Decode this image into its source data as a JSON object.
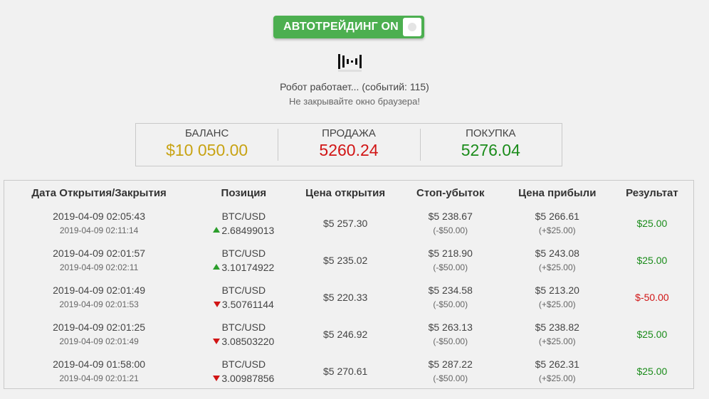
{
  "toggle": {
    "label": "АВТОТРЕЙДИНГ ON",
    "state": "on",
    "color": "#4caf50"
  },
  "status": {
    "loader_icon": "audio-bars-loader-icon",
    "main": "Робот работает... (событий: 115)",
    "sub": "Не закрывайте окно браузера!"
  },
  "stats": {
    "balance": {
      "label": "БАЛАНС",
      "value": "$10 050.00",
      "color": "#c8a313"
    },
    "sell": {
      "label": "ПРОДАЖА",
      "value": "5260.24",
      "color": "#d11515"
    },
    "buy": {
      "label": "ПОКУПКА",
      "value": "5276.04",
      "color": "#1b8c1b"
    }
  },
  "table": {
    "headers": [
      "Дата Открытия/Закрытия",
      "Позиция",
      "Цена открытия",
      "Стоп-убыток",
      "Цена прибыли",
      "Результат"
    ],
    "rows": [
      {
        "open_date": "2019-04-09 02:05:43",
        "close_date": "2019-04-09 02:11:14",
        "pair": "BTC/USD",
        "direction": "up",
        "qty": "2.68499013",
        "open_price": "$5 257.30",
        "stop_loss": "$5 238.67",
        "stop_loss_delta": "(-$50.00)",
        "take_profit": "$5 266.61",
        "take_profit_delta": "(+$25.00)",
        "result": "$25.00"
      },
      {
        "open_date": "2019-04-09 02:01:57",
        "close_date": "2019-04-09 02:02:11",
        "pair": "BTC/USD",
        "direction": "up",
        "qty": "3.10174922",
        "open_price": "$5 235.02",
        "stop_loss": "$5 218.90",
        "stop_loss_delta": "(-$50.00)",
        "take_profit": "$5 243.08",
        "take_profit_delta": "(+$25.00)",
        "result": "$25.00"
      },
      {
        "open_date": "2019-04-09 02:01:49",
        "close_date": "2019-04-09 02:01:53",
        "pair": "BTC/USD",
        "direction": "down",
        "qty": "3.50761144",
        "open_price": "$5 220.33",
        "stop_loss": "$5 234.58",
        "stop_loss_delta": "(-$50.00)",
        "take_profit": "$5 213.20",
        "take_profit_delta": "(+$25.00)",
        "result": "$-50.00"
      },
      {
        "open_date": "2019-04-09 02:01:25",
        "close_date": "2019-04-09 02:01:49",
        "pair": "BTC/USD",
        "direction": "down",
        "qty": "3.08503220",
        "open_price": "$5 246.92",
        "stop_loss": "$5 263.13",
        "stop_loss_delta": "(-$50.00)",
        "take_profit": "$5 238.82",
        "take_profit_delta": "(+$25.00)",
        "result": "$25.00"
      },
      {
        "open_date": "2019-04-09 01:58:00",
        "close_date": "2019-04-09 02:01:21",
        "pair": "BTC/USD",
        "direction": "down",
        "qty": "3.00987856",
        "open_price": "$5 270.61",
        "stop_loss": "$5 287.22",
        "stop_loss_delta": "(-$50.00)",
        "take_profit": "$5 262.31",
        "take_profit_delta": "(+$25.00)",
        "result": "$25.00"
      }
    ]
  }
}
